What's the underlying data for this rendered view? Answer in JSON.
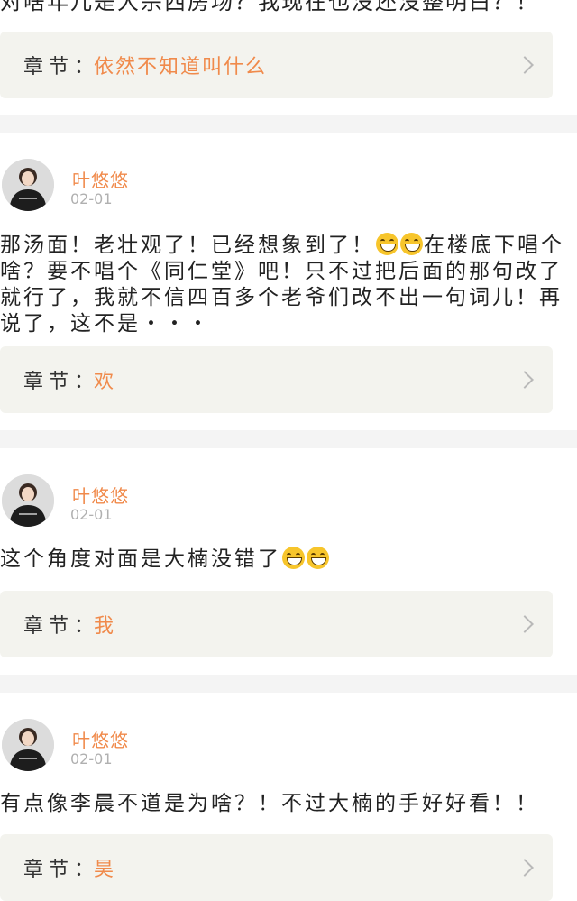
{
  "top_fragment": "对啥年儿是大宗西房场？我现在也没还没整明白？！",
  "chapter_prefix": "章节：",
  "comments": [
    {
      "chapter": "依然不知道叫什么"
    },
    {
      "username": "叶悠悠",
      "date": "02-01",
      "content_parts": [
        "那汤面！老壮观了！已经想象到了！",
        "在楼底下唱个啥？要不唱个《同仁堂》吧！只不过把后面的那句改了就行了，我就不信四百多个老爷们改不出一句词儿！再说了，这不是・・・"
      ],
      "chapter": "欢"
    },
    {
      "username": "叶悠悠",
      "date": "02-01",
      "content_parts": [
        "这个角度对面是大楠没错了"
      ],
      "chapter": "我"
    },
    {
      "username": "叶悠悠",
      "date": "02-01",
      "content_parts": [
        "有点像李晨不道是为啥？！不过大楠的手好好看！！"
      ],
      "chapter": "昊"
    }
  ],
  "icons": {
    "chevron": "chevron-right-icon",
    "emoji": "grinning-face-emoji-icon"
  },
  "colors": {
    "accent": "#f08a4b",
    "bar_bg": "#f3f3ee",
    "divider": "#f4f4f4",
    "date_gray": "#b0b0b0"
  }
}
